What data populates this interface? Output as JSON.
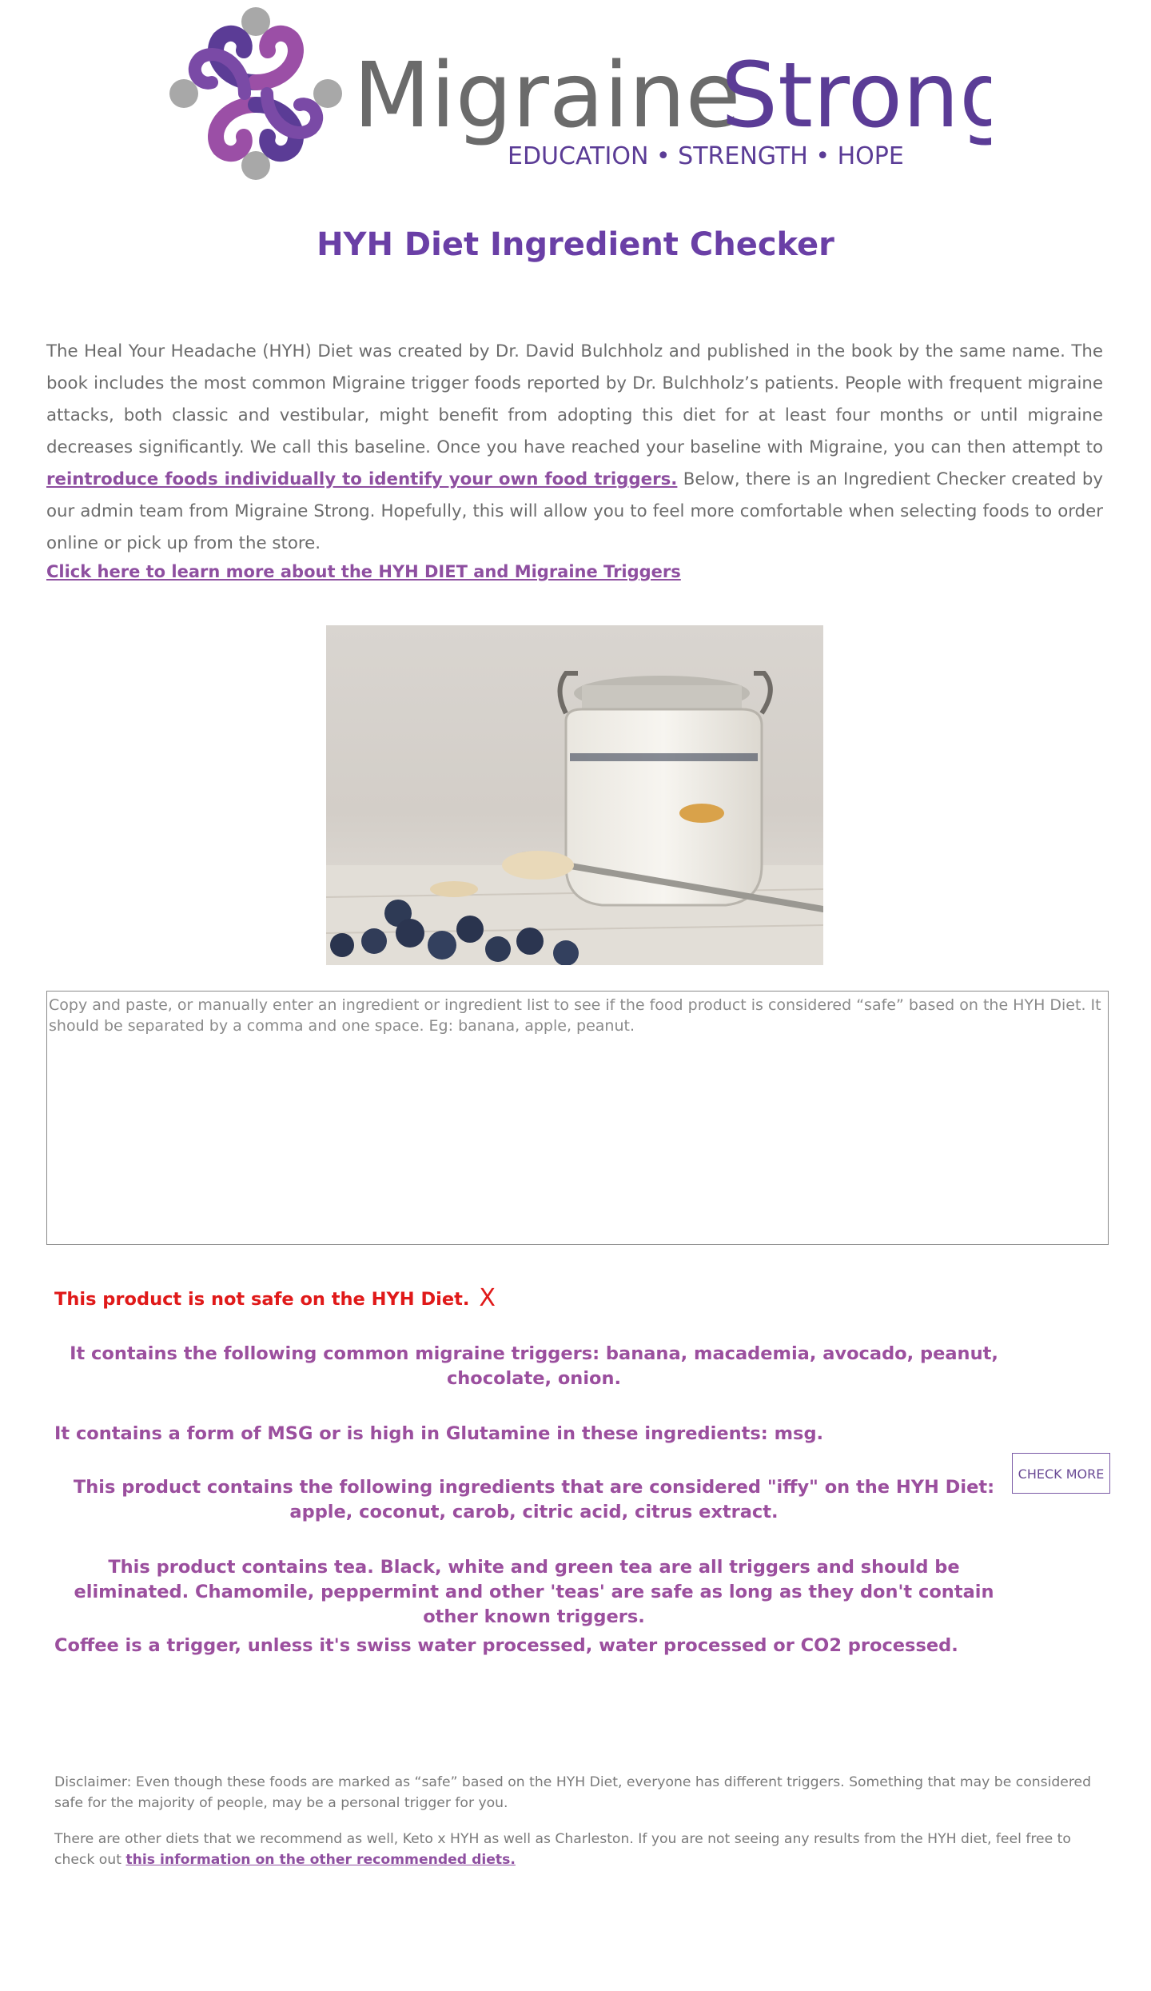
{
  "logo": {
    "brand_first": "Migraine",
    "brand_second": "Strong",
    "tagline": "EDUCATION • STRENGTH • HOPE",
    "colors": {
      "purple": "#5b3c96",
      "magenta": "#9b4fa6",
      "gray": "#6b6b6b",
      "light_gray": "#a8a8a8"
    }
  },
  "page": {
    "title": "HYH Diet Ingredient Checker"
  },
  "intro": {
    "text_before": "The Heal Your Headache (HYH) Diet was created by Dr. David Bulchholz and published in the book by the same name. The book includes the most common Migraine trigger foods reported by Dr. Bulchholz’s patients. People with frequent migraine attacks, both classic and vestibular, might benefit from adopting this diet for at least four months or until migraine decreases significantly. We call this baseline. Once you have reached your baseline with Migraine, you can then attempt to ",
    "link_text": "reintroduce foods individually to identify your own food triggers.",
    "text_after": " Below, there is an Ingredient Checker created by our admin team from Migraine Strong. Hopefully, this will allow you to feel more comfortable when selecting foods to order online or pick up from the store."
  },
  "learn_link": "Click here to learn more about the HYH DIET and Migraine Triggers",
  "photo": {
    "icon": "overnight-oats-jar-photo"
  },
  "checker": {
    "placeholder": "Copy and paste, or manually enter an ingredient or ingredient list to see if the food product is considered “safe” based on the HYH Diet. It should be separated by a comma and one space. Eg: banana, apple, peanut.",
    "value": "",
    "check_button": "CHECK MORE"
  },
  "results": {
    "unsafe": "This product is not safe on the HYH Diet.",
    "unsafe_icon": "X",
    "common_triggers": "It contains the following common migraine triggers: banana, macademia, avocado, peanut, chocolate, onion.",
    "msg": "It contains a form of MSG or is high in Glutamine in these ingredients: msg.",
    "iffy": "This product contains the following ingredients that are considered \"iffy\" on the HYH Diet: apple, coconut, carob, citric acid, citrus extract.",
    "tea": "This product contains tea. Black, white and green tea are all triggers and should be eliminated. Chamomile, peppermint and other 'teas' are safe as long as they don't contain other known triggers.",
    "coffee": "Coffee is a trigger, unless it's swiss water processed, water processed or CO2 processed.",
    "colors": {
      "unsafe": "#e01919",
      "info": "#9b4f9e"
    }
  },
  "disclaimer": {
    "text1": "Disclaimer: Even though these foods are marked as “safe” based on the HYH Diet, everyone has different triggers. Something that may be considered safe for the majority of people, may be a personal trigger for you.",
    "text2_before": "There are other diets that we recommend as well, Keto x HYH as well as Charleston. If you are not seeing any results from the HYH diet, feel free to check out ",
    "link_text": "this information on the other recommended diets."
  }
}
